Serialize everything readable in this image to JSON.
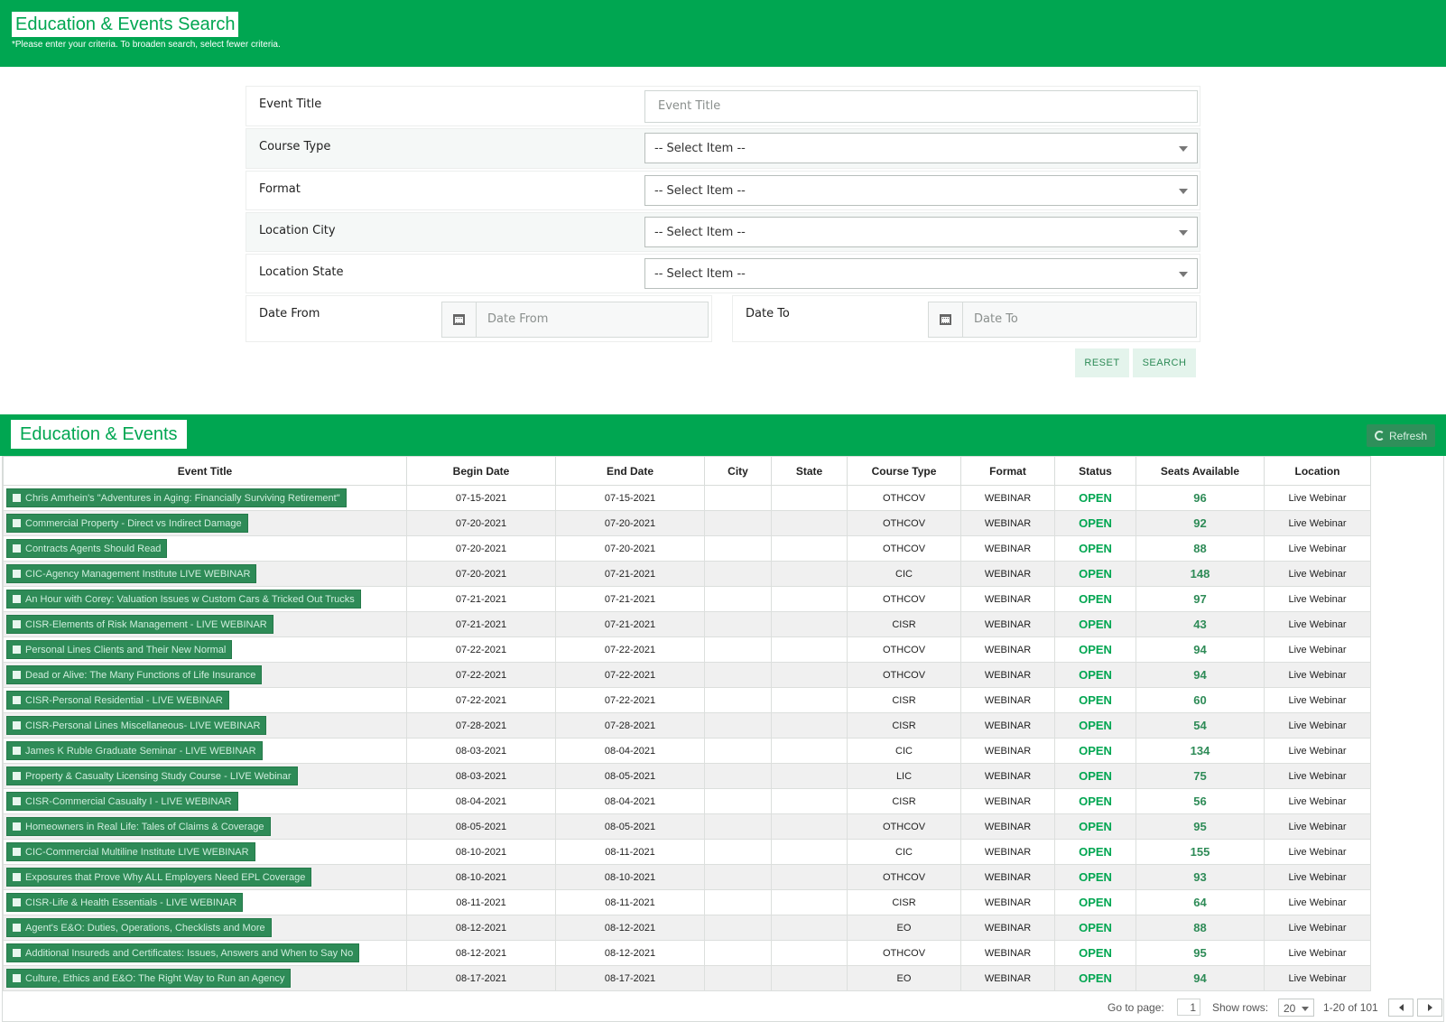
{
  "header": {
    "title": "Education & Events Search",
    "hint": "*Please enter your criteria. To broaden search, select fewer criteria."
  },
  "form": {
    "event_title": {
      "label": "Event Title",
      "placeholder": "Event Title"
    },
    "course_type": {
      "label": "Course Type",
      "value": "-- Select Item --"
    },
    "format": {
      "label": "Format",
      "value": "-- Select Item --"
    },
    "location_city": {
      "label": "Location City",
      "value": "-- Select Item --"
    },
    "location_state": {
      "label": "Location State",
      "value": "-- Select Item --"
    },
    "date_from": {
      "label": "Date From",
      "placeholder": "Date From"
    },
    "date_to": {
      "label": "Date To",
      "placeholder": "Date To"
    },
    "reset_label": "RESET",
    "search_label": "SEARCH"
  },
  "results": {
    "title": "Education & Events",
    "refresh_label": "Refresh",
    "columns": [
      "Event Title",
      "Begin Date",
      "End Date",
      "City",
      "State",
      "Course Type",
      "Format",
      "Status",
      "Seats Available",
      "Location"
    ],
    "rows": [
      {
        "title": "Chris Amrhein's \"Adventures in Aging: Financially Surviving Retirement\"",
        "begin": "07-15-2021",
        "end": "07-15-2021",
        "city": "",
        "state": "",
        "course": "OTHCOV",
        "format": "WEBINAR",
        "status": "OPEN",
        "seats": "96",
        "location": "Live Webinar"
      },
      {
        "title": "Commercial Property - Direct vs Indirect Damage",
        "begin": "07-20-2021",
        "end": "07-20-2021",
        "city": "",
        "state": "",
        "course": "OTHCOV",
        "format": "WEBINAR",
        "status": "OPEN",
        "seats": "92",
        "location": "Live Webinar"
      },
      {
        "title": "Contracts Agents Should Read",
        "begin": "07-20-2021",
        "end": "07-20-2021",
        "city": "",
        "state": "",
        "course": "OTHCOV",
        "format": "WEBINAR",
        "status": "OPEN",
        "seats": "88",
        "location": "Live Webinar"
      },
      {
        "title": "CIC-Agency Management Institute LIVE WEBINAR",
        "begin": "07-20-2021",
        "end": "07-21-2021",
        "city": "",
        "state": "",
        "course": "CIC",
        "format": "WEBINAR",
        "status": "OPEN",
        "seats": "148",
        "location": "Live Webinar"
      },
      {
        "title": "An Hour with Corey: Valuation Issues w Custom Cars & Tricked Out Trucks",
        "begin": "07-21-2021",
        "end": "07-21-2021",
        "city": "",
        "state": "",
        "course": "OTHCOV",
        "format": "WEBINAR",
        "status": "OPEN",
        "seats": "97",
        "location": "Live Webinar"
      },
      {
        "title": "CISR-Elements of Risk Management - LIVE WEBINAR",
        "begin": "07-21-2021",
        "end": "07-21-2021",
        "city": "",
        "state": "",
        "course": "CISR",
        "format": "WEBINAR",
        "status": "OPEN",
        "seats": "43",
        "location": "Live Webinar"
      },
      {
        "title": "Personal Lines Clients and Their New Normal",
        "begin": "07-22-2021",
        "end": "07-22-2021",
        "city": "",
        "state": "",
        "course": "OTHCOV",
        "format": "WEBINAR",
        "status": "OPEN",
        "seats": "94",
        "location": "Live Webinar"
      },
      {
        "title": "Dead or Alive: The Many Functions of Life Insurance",
        "begin": "07-22-2021",
        "end": "07-22-2021",
        "city": "",
        "state": "",
        "course": "OTHCOV",
        "format": "WEBINAR",
        "status": "OPEN",
        "seats": "94",
        "location": "Live Webinar"
      },
      {
        "title": "CISR-Personal Residential - LIVE WEBINAR",
        "begin": "07-22-2021",
        "end": "07-22-2021",
        "city": "",
        "state": "",
        "course": "CISR",
        "format": "WEBINAR",
        "status": "OPEN",
        "seats": "60",
        "location": "Live Webinar"
      },
      {
        "title": "CISR-Personal Lines Miscellaneous- LIVE WEBINAR",
        "begin": "07-28-2021",
        "end": "07-28-2021",
        "city": "",
        "state": "",
        "course": "CISR",
        "format": "WEBINAR",
        "status": "OPEN",
        "seats": "54",
        "location": "Live Webinar"
      },
      {
        "title": "James K Ruble Graduate Seminar - LIVE WEBINAR",
        "begin": "08-03-2021",
        "end": "08-04-2021",
        "city": "",
        "state": "",
        "course": "CIC",
        "format": "WEBINAR",
        "status": "OPEN",
        "seats": "134",
        "location": "Live Webinar"
      },
      {
        "title": "Property & Casualty Licensing Study Course - LIVE Webinar",
        "begin": "08-03-2021",
        "end": "08-05-2021",
        "city": "",
        "state": "",
        "course": "LIC",
        "format": "WEBINAR",
        "status": "OPEN",
        "seats": "75",
        "location": "Live Webinar"
      },
      {
        "title": "CISR-Commercial Casualty I - LIVE WEBINAR",
        "begin": "08-04-2021",
        "end": "08-04-2021",
        "city": "",
        "state": "",
        "course": "CISR",
        "format": "WEBINAR",
        "status": "OPEN",
        "seats": "56",
        "location": "Live Webinar"
      },
      {
        "title": "Homeowners in Real Life: Tales of Claims & Coverage",
        "begin": "08-05-2021",
        "end": "08-05-2021",
        "city": "",
        "state": "",
        "course": "OTHCOV",
        "format": "WEBINAR",
        "status": "OPEN",
        "seats": "95",
        "location": "Live Webinar"
      },
      {
        "title": "CIC-Commercial Multiline Institute LIVE WEBINAR",
        "begin": "08-10-2021",
        "end": "08-11-2021",
        "city": "",
        "state": "",
        "course": "CIC",
        "format": "WEBINAR",
        "status": "OPEN",
        "seats": "155",
        "location": "Live Webinar"
      },
      {
        "title": "Exposures that Prove Why ALL Employers Need EPL Coverage",
        "begin": "08-10-2021",
        "end": "08-10-2021",
        "city": "",
        "state": "",
        "course": "OTHCOV",
        "format": "WEBINAR",
        "status": "OPEN",
        "seats": "93",
        "location": "Live Webinar"
      },
      {
        "title": "CISR-Life & Health Essentials - LIVE WEBINAR",
        "begin": "08-11-2021",
        "end": "08-11-2021",
        "city": "",
        "state": "",
        "course": "CISR",
        "format": "WEBINAR",
        "status": "OPEN",
        "seats": "64",
        "location": "Live Webinar"
      },
      {
        "title": "Agent's E&O: Duties, Operations, Checklists and More",
        "begin": "08-12-2021",
        "end": "08-12-2021",
        "city": "",
        "state": "",
        "course": "EO",
        "format": "WEBINAR",
        "status": "OPEN",
        "seats": "88",
        "location": "Live Webinar"
      },
      {
        "title": "Additional Insureds and Certificates: Issues, Answers and When to Say No",
        "begin": "08-12-2021",
        "end": "08-12-2021",
        "city": "",
        "state": "",
        "course": "OTHCOV",
        "format": "WEBINAR",
        "status": "OPEN",
        "seats": "95",
        "location": "Live Webinar"
      },
      {
        "title": "Culture, Ethics and E&O: The Right Way to Run an Agency",
        "begin": "08-17-2021",
        "end": "08-17-2021",
        "city": "",
        "state": "",
        "course": "EO",
        "format": "WEBINAR",
        "status": "OPEN",
        "seats": "94",
        "location": "Live Webinar"
      }
    ]
  },
  "pager": {
    "go_to_label": "Go to page:",
    "page": "1",
    "show_rows_label": "Show rows:",
    "rows_value": "20",
    "range": "1-20 of 101"
  },
  "colors": {
    "brand_green": "#00a651",
    "button_green": "#2e8b57"
  },
  "icons": {
    "event": "calendar-icon",
    "date": "calendar-icon",
    "refresh": "refresh-icon"
  }
}
